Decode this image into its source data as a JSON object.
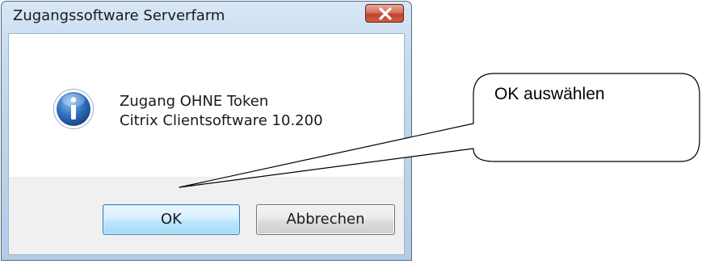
{
  "dialog": {
    "title": "Zugangssoftware Serverfarm",
    "close_icon": "close-x-icon",
    "message_icon": "information-icon",
    "message_lines": [
      "Zugang OHNE Token",
      "Citrix Clientsoftware 10.200"
    ],
    "buttons": {
      "ok_label": "OK",
      "cancel_label": "Abbrechen"
    },
    "colors": {
      "close_button": "#c7472f",
      "ok_border": "#3c7fb1",
      "info_icon": "#2f6fbf"
    }
  },
  "annotation": {
    "callout_text": "OK auswählen"
  }
}
